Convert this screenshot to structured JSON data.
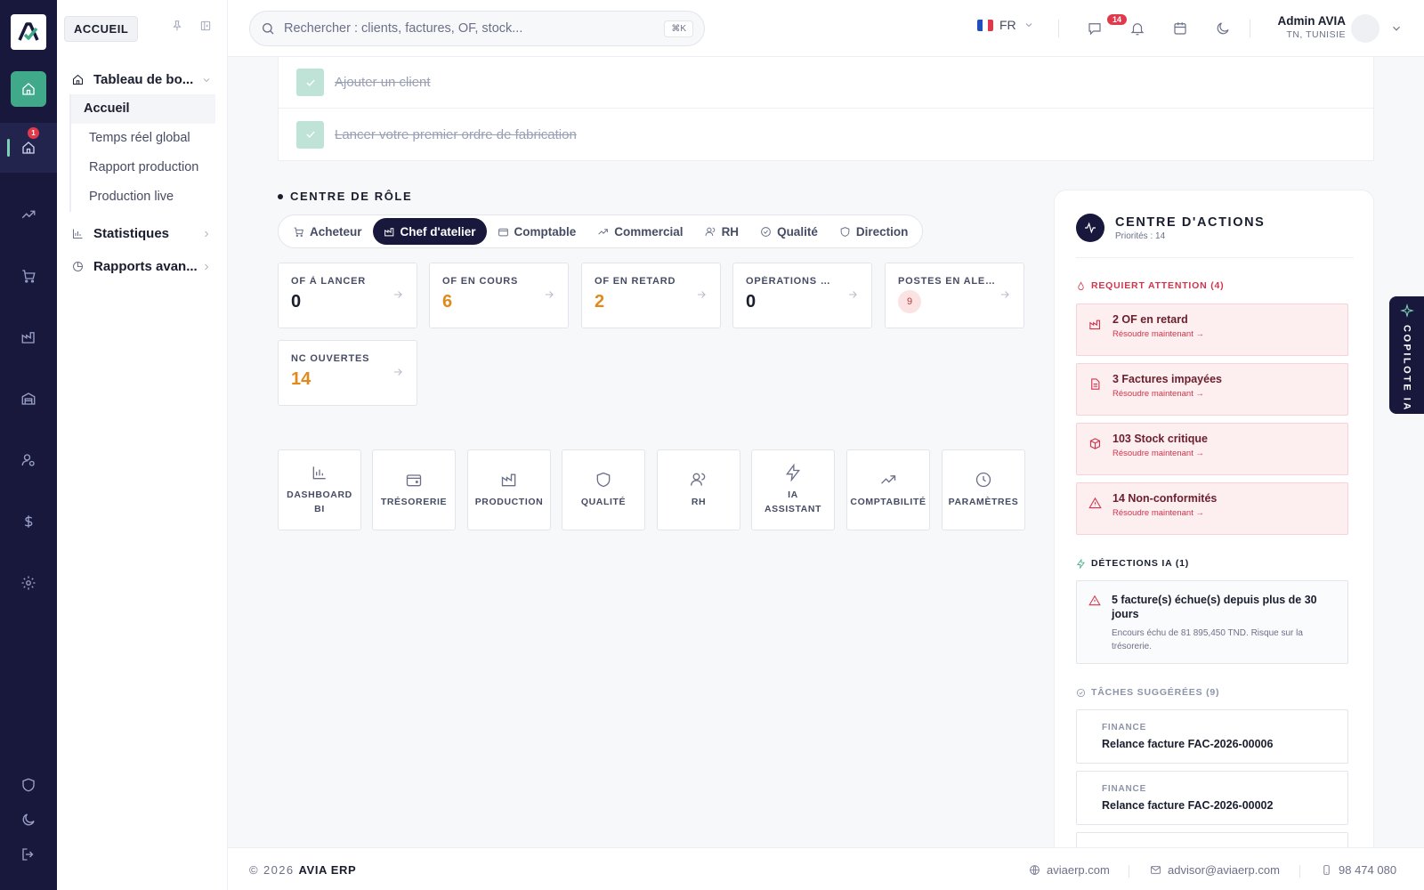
{
  "sidebar": {
    "section_chip": "ACCUEIL",
    "groups": [
      {
        "label": "Tableau de bo..."
      },
      {
        "label": "Statistiques"
      },
      {
        "label": "Rapports avan..."
      }
    ],
    "subitems": [
      "Accueil",
      "Temps réel global",
      "Rapport production",
      "Production live"
    ],
    "rail_badge": "1"
  },
  "topbar": {
    "search_placeholder": "Rechercher : clients, factures, OF, stock...",
    "shortcut": "⌘K",
    "lang": "FR",
    "notif_count": "14",
    "user_name": "Admin AVIA",
    "user_location": "TN, TUNISIE"
  },
  "checklist": [
    "Ajouter un client",
    "Lancer votre premier ordre de fabrication"
  ],
  "role_center": {
    "title": "CENTRE DE RÔLE",
    "tabs": [
      "Acheteur",
      "Chef d'atelier",
      "Comptable",
      "Commercial",
      "RH",
      "Qualité",
      "Direction"
    ],
    "active_tab": "Chef d'atelier"
  },
  "kpis": [
    {
      "label": "OF À LANCER",
      "value": "0"
    },
    {
      "label": "OF EN COURS",
      "value": "6"
    },
    {
      "label": "OF EN RETARD",
      "value": "2"
    },
    {
      "label": "OPÉRATIONS E...",
      "value": "0"
    },
    {
      "label": "POSTES EN ALERT",
      "value": "9"
    },
    {
      "label": "NC OUVERTES",
      "value": "14"
    }
  ],
  "shortcuts": [
    {
      "label": "DASHBOARD\nBI",
      "icon": "bar-chart-icon"
    },
    {
      "label": "TRÉSORERIE",
      "icon": "wallet-icon"
    },
    {
      "label": "PRODUCTION",
      "icon": "factory-icon"
    },
    {
      "label": "QUALITÉ",
      "icon": "shield-icon"
    },
    {
      "label": "RH",
      "icon": "users-icon"
    },
    {
      "label": "IA\nASSISTANT",
      "icon": "bolt-icon"
    },
    {
      "label": "COMPTABILITÉ",
      "icon": "trend-icon"
    },
    {
      "label": "PARAMÈTRES",
      "icon": "clock-icon"
    }
  ],
  "actions": {
    "title": "CENTRE D'ACTIONS",
    "subtitle": "Priorités : 14",
    "attention_label": "REQUIERT ATTENTION (4)",
    "alerts": [
      {
        "title": "2 OF en retard",
        "cta": "Résoudre maintenant →"
      },
      {
        "title": "3 Factures impayées",
        "cta": "Résoudre maintenant →"
      },
      {
        "title": "103 Stock critique",
        "cta": "Résoudre maintenant →"
      },
      {
        "title": "14 Non-conformités",
        "cta": "Résoudre maintenant →"
      }
    ],
    "detections_label": "DÉTECTIONS IA (1)",
    "detection": {
      "title": "5 facture(s) échue(s) depuis plus de 30 jours",
      "detail": "Encours échu de 81 895,450 TND. Risque sur la trésorerie."
    },
    "tasks_label": "TÂCHES SUGGÉRÉES (9)",
    "tasks": [
      {
        "category": "FINANCE",
        "title": "Relance facture FAC-2026-00006"
      },
      {
        "category": "FINANCE",
        "title": "Relance facture FAC-2026-00002"
      }
    ]
  },
  "copilot_label": "COPILOTE IA",
  "footer": {
    "copyright": "© 2026",
    "brand": "AVIA ERP",
    "website": "aviaerp.com",
    "email": "advisor@aviaerp.com",
    "phone": "98 474 080"
  },
  "colors": {
    "rail": "#17183b",
    "accent": "#3fa98a",
    "orange": "#e08a1e",
    "alert_red": "#d1344b"
  }
}
